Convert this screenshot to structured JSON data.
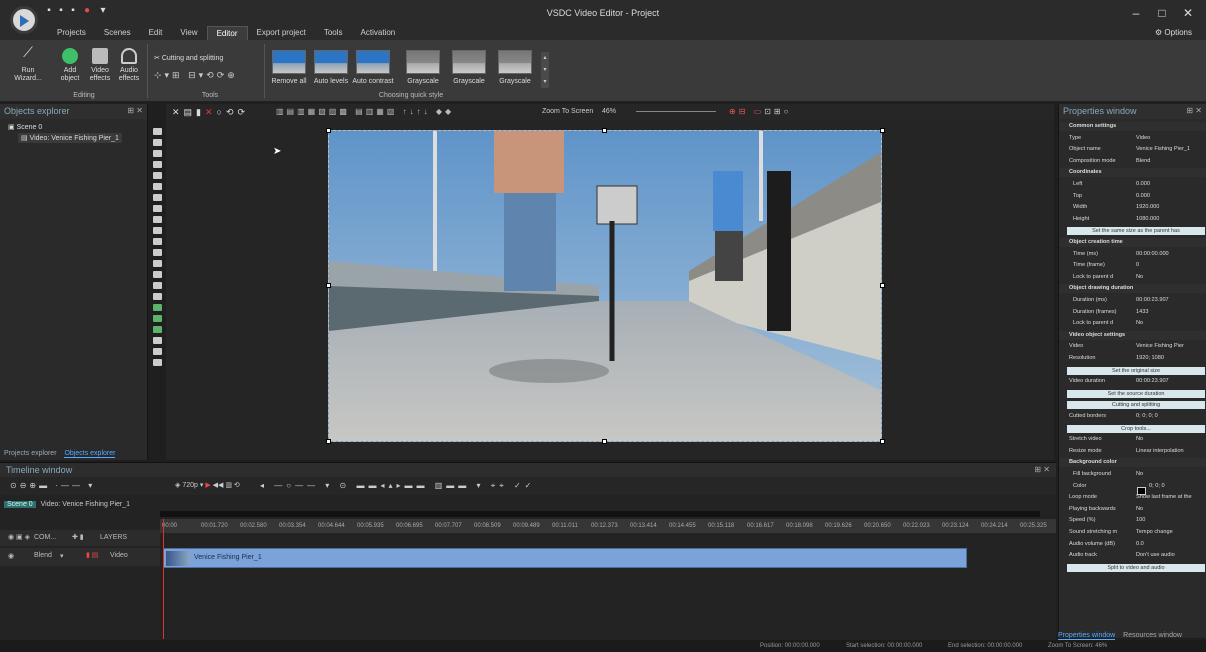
{
  "app": {
    "title": "VSDC Video Editor - Project",
    "options_label": "Options"
  },
  "menu": {
    "items": [
      "Projects",
      "Scenes",
      "Edit",
      "View",
      "Editor",
      "Export project",
      "Tools",
      "Activation"
    ],
    "active": "Editor"
  },
  "ribbon": {
    "run_wizard": "Run Wizard...",
    "add_object": "Add object",
    "video_effects": "Video effects",
    "audio_effects": "Audio effects",
    "editing_label": "Editing",
    "cutting_splitting": "Cutting and splitting",
    "tools_label": "Tools",
    "quick_styles": [
      "Remove all",
      "Auto levels",
      "Auto contrast",
      "Grayscale",
      "Grayscale",
      "Grayscale"
    ],
    "quick_style_label": "Choosing quick style"
  },
  "objects_explorer": {
    "title": "Objects explorer",
    "scene": "Scene 0",
    "video_item": "Video: Venice Fishing Pier_1",
    "tabs": [
      "Projects explorer",
      "Objects explorer"
    ]
  },
  "editor_toolbar": {
    "zoom_label": "Zoom To Screen",
    "zoom_value": "46%"
  },
  "timeline": {
    "title": "Timeline window",
    "resolution": "720p",
    "scene_tab": "Scene 0",
    "video_tab": "Video: Venice Fishing Pier_1",
    "layers_label": "LAYERS",
    "com_label": "COM...",
    "blend_label": "Blend",
    "video_label": "Video",
    "clip_name": "Venice Fishing Pier_1",
    "ruler": [
      "00:00",
      "00:01.720",
      "00:02.580",
      "00:03.354",
      "00:04.644",
      "00:05.935",
      "00:06.695",
      "00:07.707",
      "00:08.509",
      "00:09.489",
      "00:11.011",
      "00:12.373",
      "00:13.414",
      "00:14.455",
      "00:15.118",
      "00:16.617",
      "00:18.098",
      "00:19.626",
      "00:20.650",
      "00:22.023",
      "00:23.124",
      "00:24.214",
      "00:25.325"
    ]
  },
  "properties": {
    "title": "Properties window",
    "rows": [
      {
        "type": "sec",
        "k": "Common settings",
        "v": ""
      },
      {
        "type": "row",
        "k": "Type",
        "v": "Video"
      },
      {
        "type": "row",
        "k": "Object name",
        "v": "Venice Fishing Pier_1"
      },
      {
        "type": "row",
        "k": "Composition mode",
        "v": "Blend"
      },
      {
        "type": "sec",
        "k": "Coordinates",
        "v": ""
      },
      {
        "type": "sub",
        "k": "Left",
        "v": "0.000"
      },
      {
        "type": "sub",
        "k": "Top",
        "v": "0.000"
      },
      {
        "type": "sub",
        "k": "Width",
        "v": "1920.000"
      },
      {
        "type": "sub",
        "k": "Height",
        "v": "1080.000"
      },
      {
        "type": "btn",
        "k": "Set the same size as the parent has",
        "v": ""
      },
      {
        "type": "sec",
        "k": "Object creation time",
        "v": ""
      },
      {
        "type": "sub",
        "k": "Time (ms)",
        "v": "00:00:00.000"
      },
      {
        "type": "sub",
        "k": "Time (frame)",
        "v": "0"
      },
      {
        "type": "sub",
        "k": "Lock to parent d",
        "v": "No"
      },
      {
        "type": "sec",
        "k": "Object drawing duration",
        "v": ""
      },
      {
        "type": "sub",
        "k": "Duration (ms)",
        "v": "00:00:23.907"
      },
      {
        "type": "sub",
        "k": "Duration (frames)",
        "v": "1433"
      },
      {
        "type": "sub",
        "k": "Lock to parent d",
        "v": "No"
      },
      {
        "type": "sec",
        "k": "Video object settings",
        "v": ""
      },
      {
        "type": "row",
        "k": "Video",
        "v": "Venice Fishing Pier"
      },
      {
        "type": "row",
        "k": "Resolution",
        "v": "1920; 1080"
      },
      {
        "type": "btn",
        "k": "Set the original size",
        "v": ""
      },
      {
        "type": "row",
        "k": "Video duration",
        "v": "00:00:23.907"
      },
      {
        "type": "btn",
        "k": "Set the source duration",
        "v": ""
      },
      {
        "type": "btn",
        "k": "Cutting and splitting",
        "v": ""
      },
      {
        "type": "row",
        "k": "Cutted borders",
        "v": "0; 0; 0; 0"
      },
      {
        "type": "btn",
        "k": "Crop tools...",
        "v": ""
      },
      {
        "type": "row",
        "k": "Stretch video",
        "v": "No"
      },
      {
        "type": "row",
        "k": "Resize mode",
        "v": "Linear interpolation"
      },
      {
        "type": "sec",
        "k": "Background color",
        "v": ""
      },
      {
        "type": "sub",
        "k": "Fill background",
        "v": "No"
      },
      {
        "type": "sub",
        "k": "Color",
        "v": "0; 0; 0"
      },
      {
        "type": "row",
        "k": "Loop mode",
        "v": "Show last frame at the"
      },
      {
        "type": "row",
        "k": "Playing backwards",
        "v": "No"
      },
      {
        "type": "row",
        "k": "Speed (%)",
        "v": "100"
      },
      {
        "type": "row",
        "k": "Sound stretching m",
        "v": "Tempo change"
      },
      {
        "type": "row",
        "k": "Audio volume (dB)",
        "v": "0.0"
      },
      {
        "type": "row",
        "k": "Audio track",
        "v": "Don't use audio"
      },
      {
        "type": "btn",
        "k": "Split to video and audio",
        "v": ""
      }
    ],
    "tabs": [
      "Properties window",
      "Resources window"
    ]
  },
  "status": {
    "position": "Position: 00:00:00.000",
    "start": "Start selection: 00:00:00.000",
    "end": "End selection: 00:00:00.000",
    "zoom": "Zoom To Screen: 46%"
  }
}
